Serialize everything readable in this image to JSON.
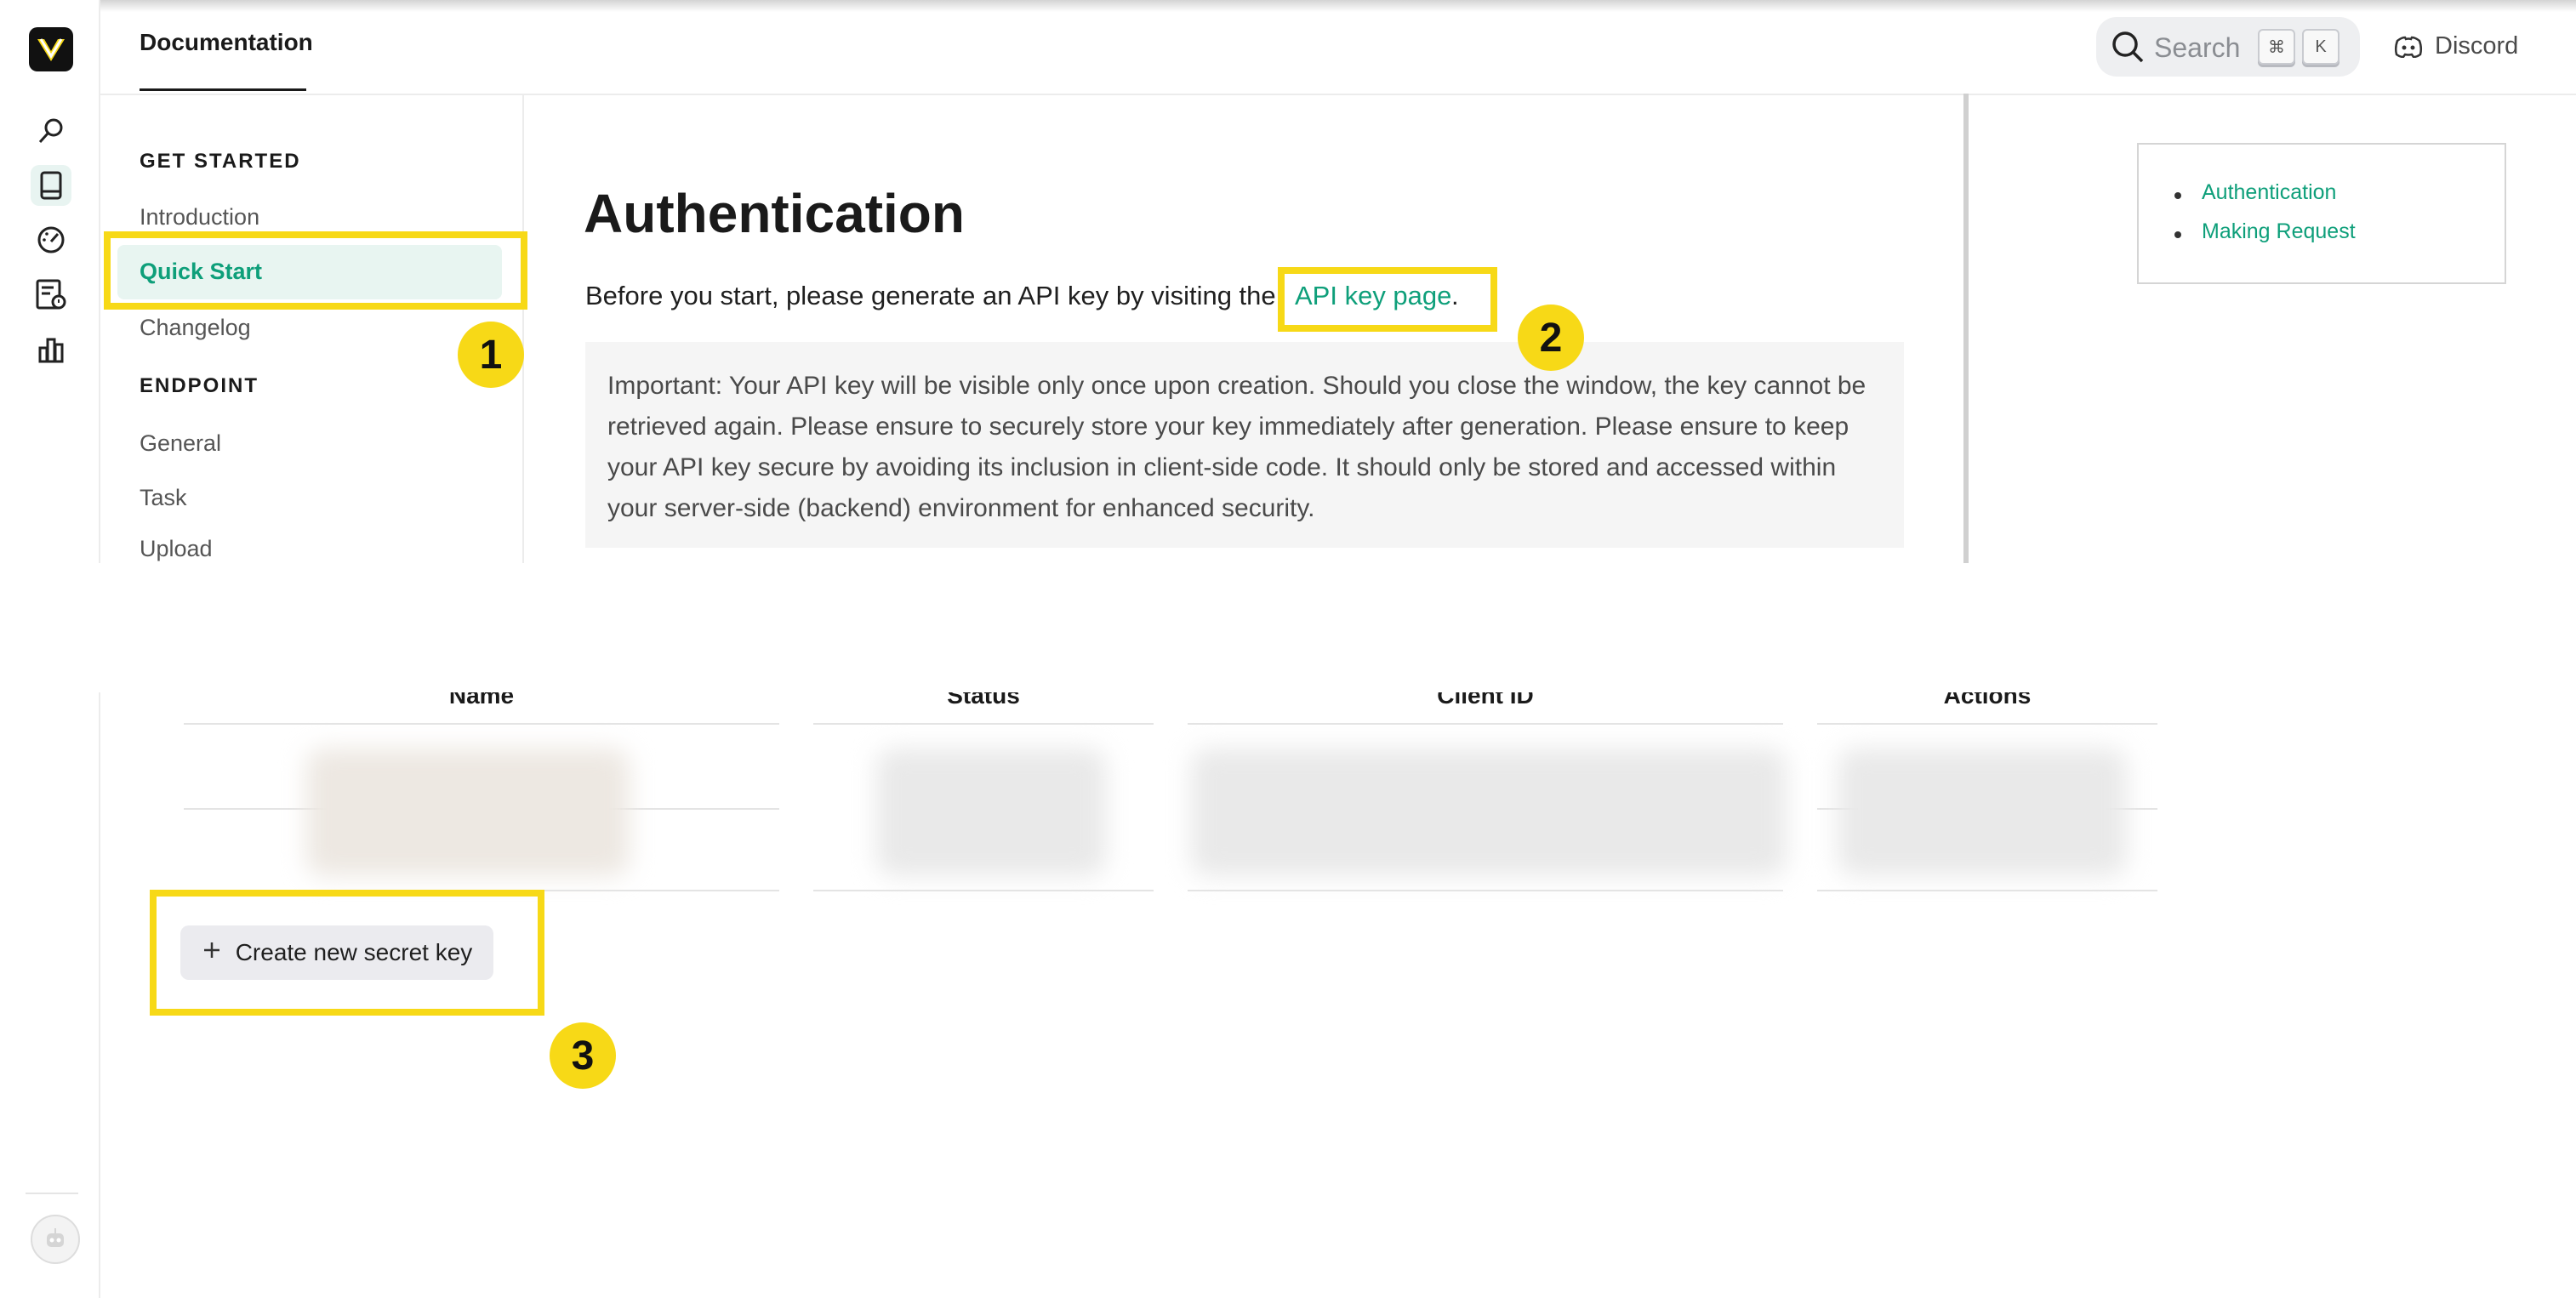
{
  "header": {
    "tab": "Documentation",
    "search": {
      "placeholder": "Search",
      "shortcut_mod": "⌘",
      "shortcut_key": "K"
    },
    "discord_label": "Discord"
  },
  "rail": {
    "icons": [
      "search-icon",
      "book-icon",
      "dashboard-gauge-icon",
      "task-list-icon",
      "bar-chart-icon"
    ],
    "active": "book-icon"
  },
  "sidebar": {
    "sections": [
      {
        "heading": "GET STARTED",
        "items": [
          "Introduction",
          "Quick Start",
          "Changelog"
        ]
      },
      {
        "heading": "ENDPOINT",
        "items": [
          "General",
          "Task",
          "Upload"
        ]
      }
    ],
    "active_item": "Quick Start"
  },
  "main": {
    "title": "Authentication",
    "intro": "Before you start, please generate an API key by visiting the",
    "link": "API key page",
    "link_suffix": ".",
    "note": "Important: Your API key will be visible only once upon creation. Should you close the window, the key cannot be retrieved again. Please ensure to securely store your key immediately after generation. Please ensure to keep your API key secure by avoiding its inclusion in client-side code. It should only be stored and accessed within your server-side (backend) environment for enhanced security."
  },
  "toc": {
    "items": [
      "Authentication",
      "Making Request"
    ]
  },
  "keys_table": {
    "columns": [
      "Name",
      "Status",
      "Client ID",
      "Actions"
    ],
    "create_button": "Create new secret key"
  },
  "annotations": [
    "1",
    "2",
    "3"
  ],
  "colors": {
    "accent": "#0e9f7a",
    "highlight": "#f7d917"
  }
}
